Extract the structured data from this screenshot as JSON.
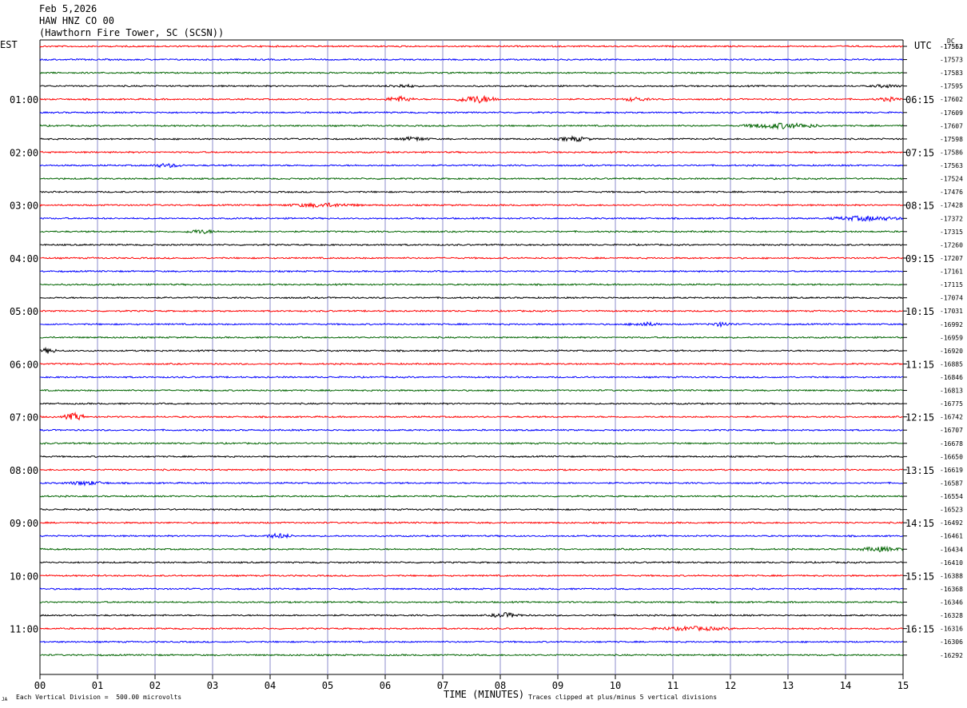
{
  "header": {
    "date": "Feb 5,2026",
    "channel": "HAW HNZ CO 00",
    "station": "(Hawthorn Fire Tower, SC (SCSN))"
  },
  "left_tz": "EST",
  "right_tz": "UTC",
  "right_unit": "DC",
  "footer": {
    "scale_note": "Each Vertical Division =  500.00 microvolts",
    "clip_note": "Traces clipped at plus/minus 5 vertical divisions",
    "corner_mark": "JA"
  },
  "chart_data": {
    "type": "line",
    "title": "",
    "xlabel": "TIME (MINUTES)",
    "xlim": [
      0,
      15
    ],
    "x_ticks": [
      "00",
      "01",
      "02",
      "03",
      "04",
      "05",
      "06",
      "07",
      "08",
      "09",
      "10",
      "11",
      "12",
      "13",
      "14",
      "15"
    ],
    "trace_count": 47,
    "trace_colors": [
      "#000000",
      "#ff0000",
      "#0000ff",
      "#006400"
    ],
    "first_trace_color_index": 1,
    "grid": true,
    "left_hour_labels": [
      {
        "trace": 4,
        "label": "01:00"
      },
      {
        "trace": 8,
        "label": "02:00"
      },
      {
        "trace": 12,
        "label": "03:00"
      },
      {
        "trace": 16,
        "label": "04:00"
      },
      {
        "trace": 20,
        "label": "05:00"
      },
      {
        "trace": 24,
        "label": "06:00"
      },
      {
        "trace": 28,
        "label": "07:00"
      },
      {
        "trace": 32,
        "label": "08:00"
      },
      {
        "trace": 36,
        "label": "09:00"
      },
      {
        "trace": 40,
        "label": "10:00"
      },
      {
        "trace": 44,
        "label": "11:00"
      }
    ],
    "right_hour_labels": [
      {
        "trace": 4,
        "label": "06:15"
      },
      {
        "trace": 8,
        "label": "07:15"
      },
      {
        "trace": 12,
        "label": "08:15"
      },
      {
        "trace": 16,
        "label": "09:15"
      },
      {
        "trace": 20,
        "label": "10:15"
      },
      {
        "trace": 24,
        "label": "11:15"
      },
      {
        "trace": 28,
        "label": "12:15"
      },
      {
        "trace": 32,
        "label": "13:15"
      },
      {
        "trace": 36,
        "label": "14:15"
      },
      {
        "trace": 40,
        "label": "15:15"
      },
      {
        "trace": 44,
        "label": "16:15"
      }
    ],
    "dc_offsets": [
      "-17552",
      "-17563",
      "-17573",
      "-17583",
      "-17595",
      "-17602",
      "-17609",
      "-17607",
      "-17598",
      "-17586",
      "-17563",
      "-17524",
      "-17476",
      "-17428",
      "-17372",
      "-17315",
      "-17260",
      "-17207",
      "-17161",
      "-17115",
      "-17074",
      "-17031",
      "-16992",
      "-16959",
      "-16920",
      "-16885",
      "-16846",
      "-16813",
      "-16775",
      "-16742",
      "-16707",
      "-16678",
      "-16650",
      "-16619",
      "-16587",
      "-16554",
      "-16523",
      "-16492",
      "-16461",
      "-16434",
      "-16410",
      "-16388",
      "-16368",
      "-16346",
      "-16328",
      "-16316",
      "-16306",
      "-16292"
    ],
    "events": [
      {
        "trace": 3,
        "start": 6.0,
        "end": 6.6,
        "amp": 2.5
      },
      {
        "trace": 3,
        "start": 14.4,
        "end": 15.0,
        "amp": 2.5
      },
      {
        "trace": 4,
        "start": 6.0,
        "end": 6.5,
        "amp": 4
      },
      {
        "trace": 4,
        "start": 7.2,
        "end": 8.0,
        "amp": 5
      },
      {
        "trace": 4,
        "start": 10.1,
        "end": 10.6,
        "amp": 3
      },
      {
        "trace": 4,
        "start": 14.5,
        "end": 15.0,
        "amp": 3
      },
      {
        "trace": 6,
        "start": 12.2,
        "end": 13.6,
        "amp": 4
      },
      {
        "trace": 7,
        "start": 6.2,
        "end": 6.8,
        "amp": 3
      },
      {
        "trace": 7,
        "start": 9.0,
        "end": 9.6,
        "amp": 3.5
      },
      {
        "trace": 9,
        "start": 1.9,
        "end": 2.5,
        "amp": 3
      },
      {
        "trace": 12,
        "start": 4.2,
        "end": 5.6,
        "amp": 3
      },
      {
        "trace": 13,
        "start": 13.7,
        "end": 15.0,
        "amp": 3.5
      },
      {
        "trace": 14,
        "start": 2.5,
        "end": 3.1,
        "amp": 3
      },
      {
        "trace": 21,
        "start": 10.2,
        "end": 10.8,
        "amp": 3
      },
      {
        "trace": 21,
        "start": 11.6,
        "end": 12.1,
        "amp": 3
      },
      {
        "trace": 23,
        "start": 0.0,
        "end": 0.3,
        "amp": 4
      },
      {
        "trace": 28,
        "start": 0.4,
        "end": 0.8,
        "amp": 5
      },
      {
        "trace": 33,
        "start": 0.4,
        "end": 1.2,
        "amp": 3
      },
      {
        "trace": 37,
        "start": 3.9,
        "end": 4.4,
        "amp": 3.5
      },
      {
        "trace": 38,
        "start": 14.2,
        "end": 15.0,
        "amp": 3.5
      },
      {
        "trace": 43,
        "start": 7.8,
        "end": 8.4,
        "amp": 3.5
      },
      {
        "trace": 44,
        "start": 10.6,
        "end": 12.1,
        "amp": 3
      }
    ]
  }
}
